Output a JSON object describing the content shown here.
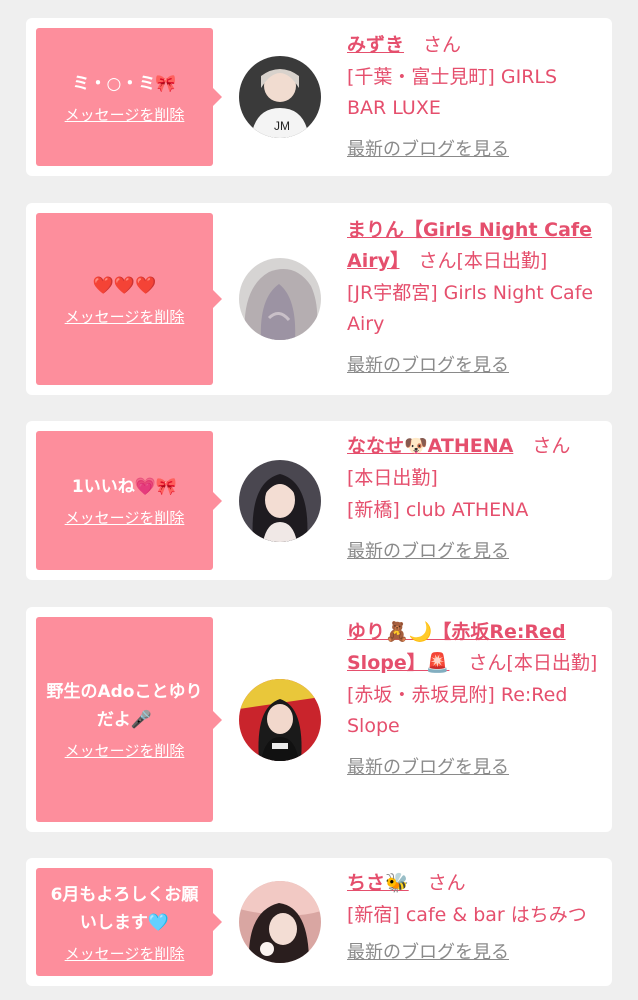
{
  "cards": [
    {
      "message": "ミ・○・ミ🎀",
      "delete_label": "メッセージを削除",
      "name": "みずき",
      "san": "　さん",
      "lines": [
        "[千葉・富士見町] GIRLS BAR LUXE"
      ],
      "blog_label": "最新のブログを見る"
    },
    {
      "message": "❤️❤️❤️",
      "delete_label": "メッセージを削除",
      "name": "まりん【Girls Night Cafe Airy】",
      "san": "　さん[本日出勤]",
      "lines": [
        "[JR宇都宮] Girls Night Cafe Airy"
      ],
      "blog_label": "最新のブログを見る"
    },
    {
      "message": "1いいね💗🎀",
      "delete_label": "メッセージを削除",
      "name": "ななせ🐶ATHENA",
      "san": "　さん",
      "lines": [
        "[本日出勤]",
        "[新橋] club ATHENA"
      ],
      "blog_label": "最新のブログを見る"
    },
    {
      "message": "野生のAdoことゆりだよ🎤",
      "delete_label": "メッセージを削除",
      "name": "ゆり🧸🌙【赤坂Re:Red Slope】🚨",
      "san": "　さん[本日出勤]",
      "lines": [
        "[赤坂・赤坂見附] Re:Red Slope"
      ],
      "blog_label": "最新のブログを見る"
    },
    {
      "message": "6月もよろしくお願いします🩵",
      "delete_label": "メッセージを削除",
      "name": "ちさ🐝",
      "san": "　さん",
      "lines": [
        "[新宿] cafe & bar はちみつ"
      ],
      "blog_label": "最新のブログを見る"
    }
  ]
}
